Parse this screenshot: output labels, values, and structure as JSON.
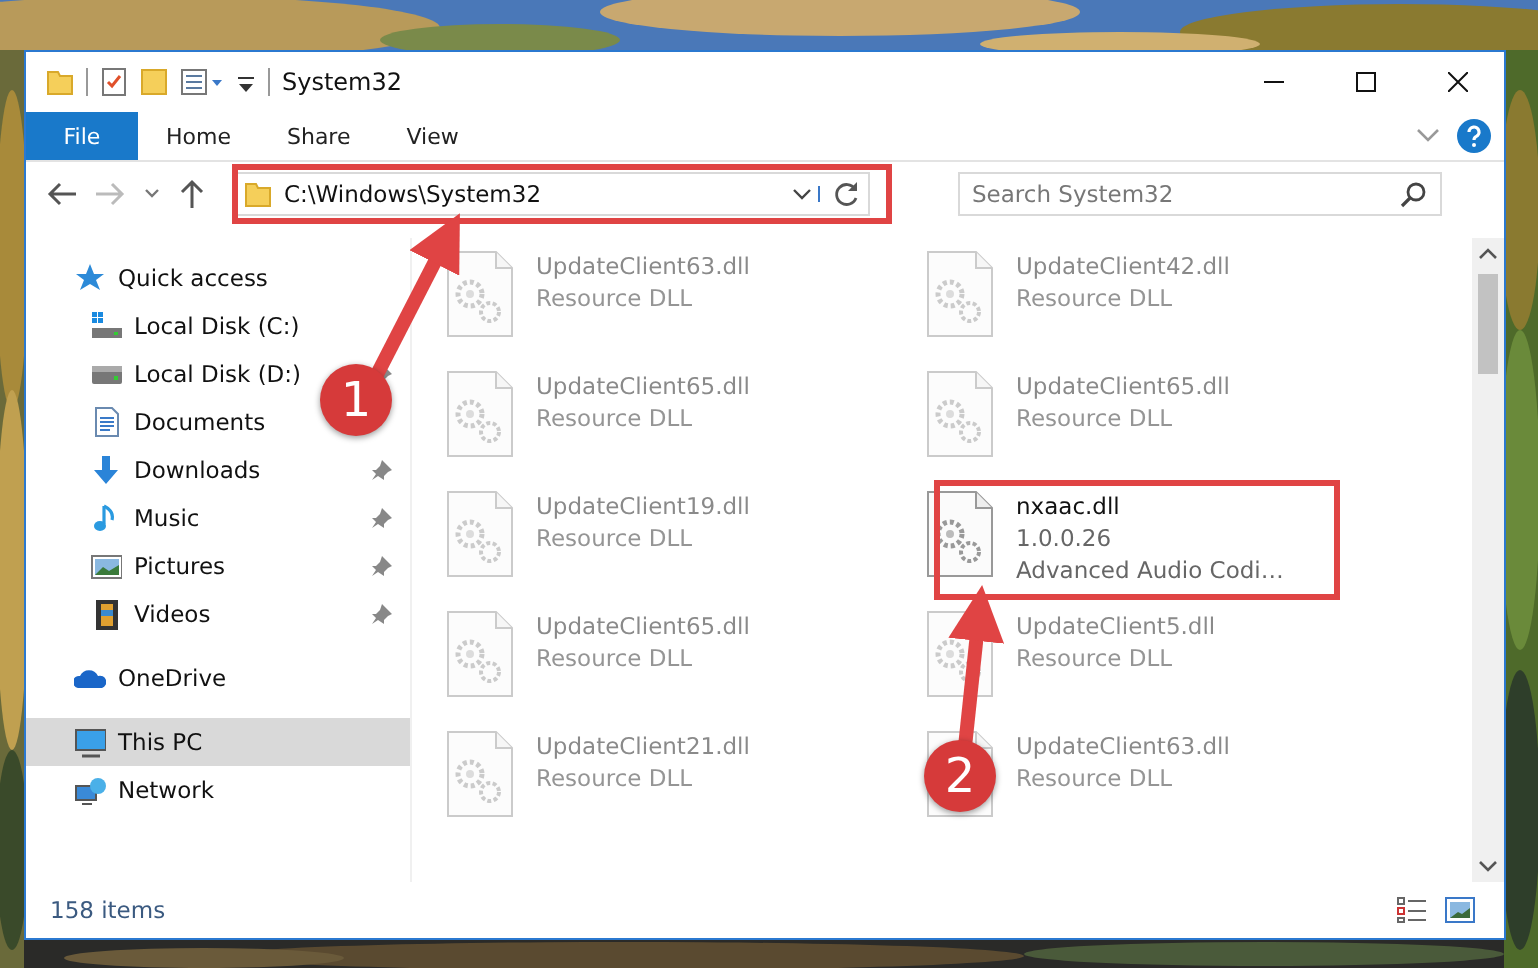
{
  "window": {
    "title": "System32"
  },
  "ribbon": {
    "file_tab": "File",
    "tabs": [
      {
        "label": "Home",
        "selected": false
      },
      {
        "label": "Share",
        "selected": false
      },
      {
        "label": "View",
        "selected": false
      }
    ]
  },
  "address_bar": {
    "path": "C:\\Windows\\System32"
  },
  "search": {
    "placeholder": "Search System32"
  },
  "sidebar": {
    "items": [
      {
        "label": "Quick access",
        "selected": false,
        "children": [
          {
            "label": "Local Disk (C:)",
            "pinned": false,
            "selected": false
          },
          {
            "label": "Local Disk (D:)",
            "pinned": true,
            "selected": false
          },
          {
            "label": "Documents",
            "pinned": false,
            "selected": false
          },
          {
            "label": "Downloads",
            "pinned": true,
            "selected": false
          },
          {
            "label": "Music",
            "pinned": true,
            "selected": false
          },
          {
            "label": "Pictures",
            "pinned": true,
            "selected": false
          },
          {
            "label": "Videos",
            "pinned": true,
            "selected": false
          }
        ]
      },
      {
        "label": "OneDrive",
        "selected": false
      },
      {
        "label": "This PC",
        "selected": true
      },
      {
        "label": "Network",
        "selected": false
      }
    ]
  },
  "files": [
    {
      "name": "UpdateClient63.dll",
      "lines": [
        "Resource DLL"
      ],
      "blurred": true
    },
    {
      "name": "UpdateClient42.dll",
      "lines": [
        "Resource DLL"
      ],
      "blurred": true
    },
    {
      "name": "UpdateClient65.dll",
      "lines": [
        "Resource DLL"
      ],
      "blurred": true
    },
    {
      "name": "UpdateClient65.dll",
      "lines": [
        "Resource DLL"
      ],
      "blurred": true
    },
    {
      "name": "UpdateClient19.dll",
      "lines": [
        "Resource DLL"
      ],
      "blurred": true
    },
    {
      "name": "nxaac.dll",
      "lines": [
        "1.0.0.26",
        "Advanced Audio Codi…"
      ],
      "blurred": false
    },
    {
      "name": "UpdateClient65.dll",
      "lines": [
        "Resource DLL"
      ],
      "blurred": true
    },
    {
      "name": "UpdateClient5.dll",
      "lines": [
        "Resource DLL"
      ],
      "blurred": true
    },
    {
      "name": "UpdateClient21.dll",
      "lines": [
        "Resource DLL"
      ],
      "blurred": true
    },
    {
      "name": "UpdateClient63.dll",
      "lines": [
        "Resource DLL"
      ],
      "blurred": true
    }
  ],
  "status_bar": {
    "count": "158 items"
  },
  "annotations": [
    {
      "label": "1"
    },
    {
      "label": "2"
    }
  ]
}
